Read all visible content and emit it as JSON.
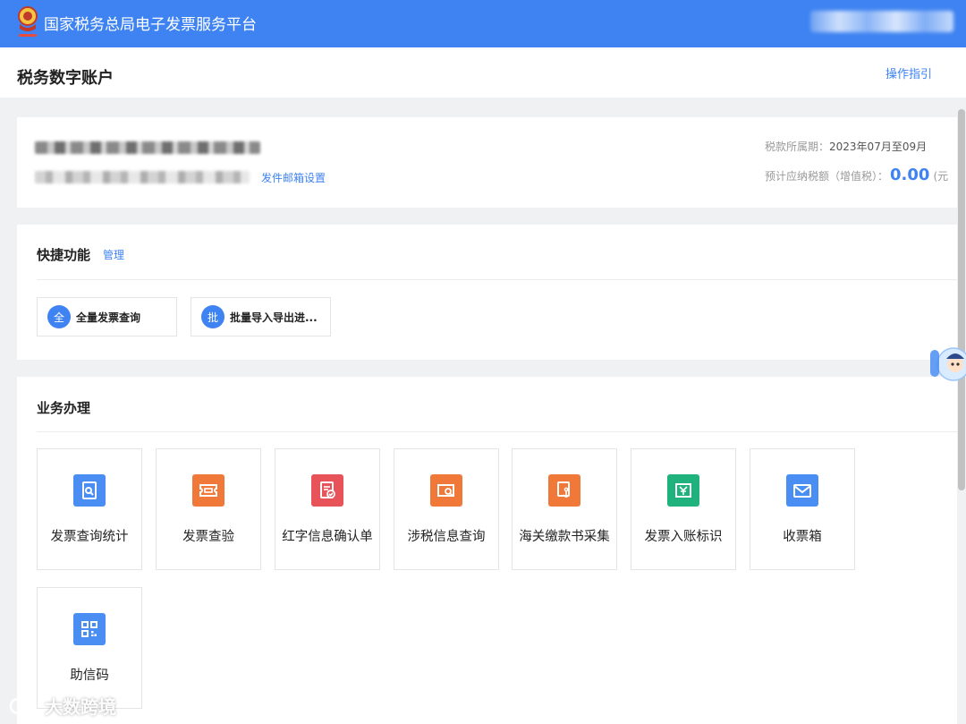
{
  "header": {
    "app_title": "国家税务总局电子发票服务平台",
    "emblem_icon": "tax-emblem-icon",
    "brand_color": "#3e83f1"
  },
  "page": {
    "title": "税务数字账户",
    "guide_link": "操作指引"
  },
  "account": {
    "mail_settings_link": "发件邮箱设置",
    "tax_period_label": "税款所属期：",
    "tax_period_value": "2023年07月至09月",
    "estimated_tax_label": "预计应纳税额（增值税）：",
    "estimated_tax_value": "0.00",
    "estimated_tax_unit_partial": "(元"
  },
  "quick_functions": {
    "title": "快捷功能",
    "manage_link": "管理",
    "items": [
      {
        "badge": "全",
        "label": "全量发票查询"
      },
      {
        "badge": "批",
        "label": "批量导入导出进..."
      }
    ]
  },
  "business": {
    "title": "业务办理",
    "tiles": [
      {
        "label": "发票查询统计",
        "icon": "invoice-search-icon",
        "color": "#4a8ef3"
      },
      {
        "label": "发票查验",
        "icon": "ticket-verify-icon",
        "color": "#f0793a"
      },
      {
        "label": "红字信息确认单",
        "icon": "red-letter-confirm-icon",
        "color": "#e8535a"
      },
      {
        "label": "涉税信息查询",
        "icon": "tax-info-search-icon",
        "color": "#f0793a"
      },
      {
        "label": "海关缴款书采集",
        "icon": "customs-anchor-icon",
        "color": "#f0793a"
      },
      {
        "label": "发票入账标识",
        "icon": "invoice-booking-icon",
        "color": "#20b27c"
      },
      {
        "label": "收票箱",
        "icon": "mail-inbox-icon",
        "color": "#4a8ef3"
      },
      {
        "label": "助信码",
        "icon": "qr-code-icon",
        "color": "#4a8ef3"
      }
    ]
  },
  "watermark": {
    "text": "大数跨境"
  }
}
